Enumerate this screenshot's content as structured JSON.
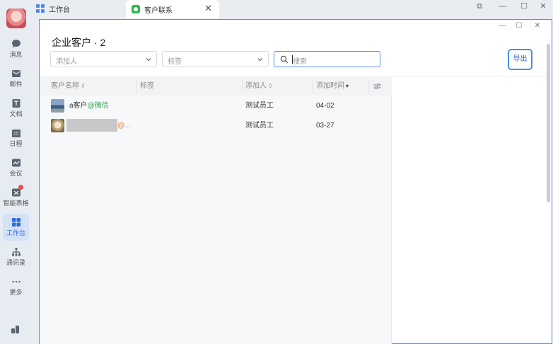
{
  "nav": {
    "items": [
      {
        "label": "消息",
        "icon": "chat-icon"
      },
      {
        "label": "邮件",
        "icon": "mail-icon"
      },
      {
        "label": "文档",
        "icon": "doc-icon"
      },
      {
        "label": "日程",
        "icon": "calendar-icon"
      },
      {
        "label": "会议",
        "icon": "meeting-icon"
      },
      {
        "label": "智能表格",
        "icon": "smart-table-icon"
      },
      {
        "label": "工作台",
        "icon": "workbench-icon"
      },
      {
        "label": "通讯录",
        "icon": "contacts-icon"
      },
      {
        "label": "更多",
        "icon": "more-icon"
      }
    ]
  },
  "tabs": [
    {
      "label": "工作台"
    },
    {
      "label": "客户联系"
    }
  ],
  "page": {
    "title": "企业客户 · 2",
    "filter_adder_placeholder": "添加人",
    "filter_tag_placeholder": "标签",
    "search_placeholder": "搜索",
    "export_label": "导出"
  },
  "table": {
    "columns": [
      "客户名称",
      "标签",
      "添加人",
      "添加时间"
    ],
    "rows": [
      {
        "name": "a客户",
        "suffix": "@微信",
        "adder": "测试员工",
        "time": "04-02"
      },
      {
        "name": "",
        "suffix": "@...",
        "adder": "测试员工",
        "time": "03-27"
      }
    ]
  },
  "colors": {
    "accent": "#2b6bde",
    "wechat": "#29a84a",
    "enterprise": "#f07b2d"
  }
}
